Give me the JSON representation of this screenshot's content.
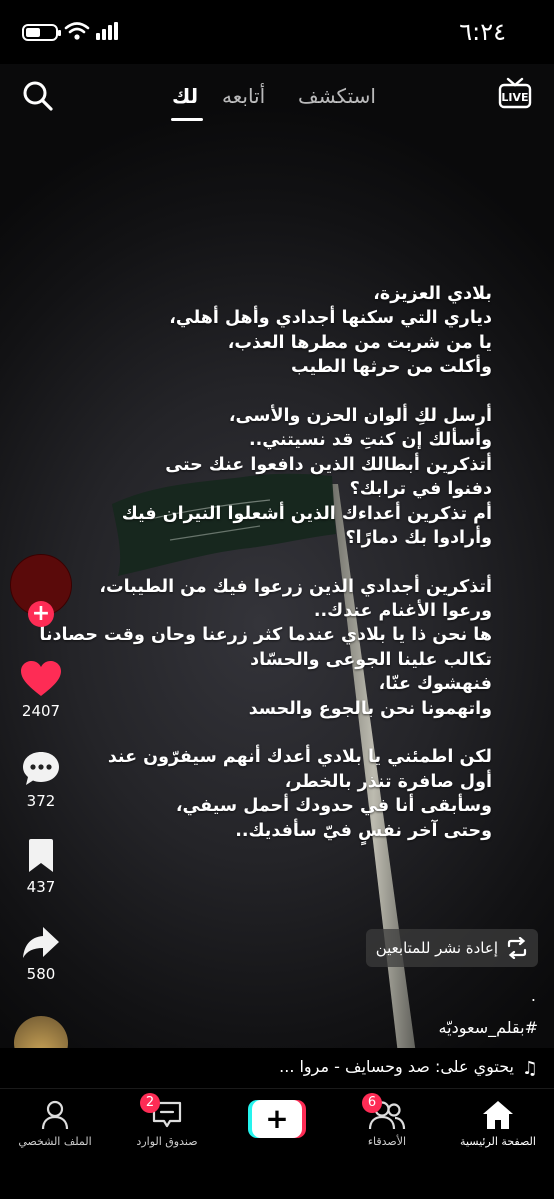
{
  "status_bar": {
    "time": "٦:٢٤"
  },
  "top_nav": {
    "tabs": [
      {
        "label": "استكشف"
      },
      {
        "label": "أتابعه"
      },
      {
        "label": "لك"
      }
    ],
    "active_tab": "لك"
  },
  "video": {
    "caption_lines": [
      "بلادي العزيزة،",
      "دياري التي سكنها أجدادي وأهل أهلي،",
      "يا من شربت من مطرها العذب،",
      "وأكلت من حرثها الطيب",
      "",
      "أرسل لكِ ألوان الحزن والأسى،",
      "وأسألك إن كنتِ قد نسيتني..",
      "أتذكرين أبطالك الذين دافعوا عنك حتى",
      "دفنوا في ترابك؟",
      "أم تذكرين أعداءك الذين أشعلوا النيران فيك",
      "وأرادوا بك دمارًا؟",
      "",
      "أتذكرين أجدادي الذين زرعوا فيك من الطيبات،",
      "ورعوا الأغنام عندك..",
      "ها نحن ذا يا بلادي عندما كثر زرعنا وحان وقت حصادنا",
      "تكالب علينا الجوعى والحسّاد",
      "فنهشوك عنّا،",
      "واتهمونا نحن بالجوع والحسد",
      "",
      "لكن اطمئني يا بلادي أعدك أنهم سيفرّون عند",
      "أول صافرة تنذر بالخطر،",
      "وسأبقى أنا في حدودك أحمل سيفي،",
      "وحتى آخر نفسٍ فيّ سأفديك.."
    ],
    "repost_label": "إعادة نشر للمتابعين",
    "dot": ".",
    "hashtag": "#بقلم_سعوديّه",
    "music_text": "يحتوي على: صد وحسايف - مروا ..."
  },
  "actions": {
    "likes": "2407",
    "comments": "372",
    "saves": "437",
    "shares": "580"
  },
  "bottom_nav": {
    "home": "الصفحة الرئيسية",
    "friends": "الأصدقاء",
    "friends_badge": "6",
    "inbox": "صندوق الوارد",
    "inbox_badge": "2",
    "profile": "الملف الشخصي"
  },
  "colors": {
    "accent": "#fe2c55",
    "accent2": "#25f4ee"
  }
}
